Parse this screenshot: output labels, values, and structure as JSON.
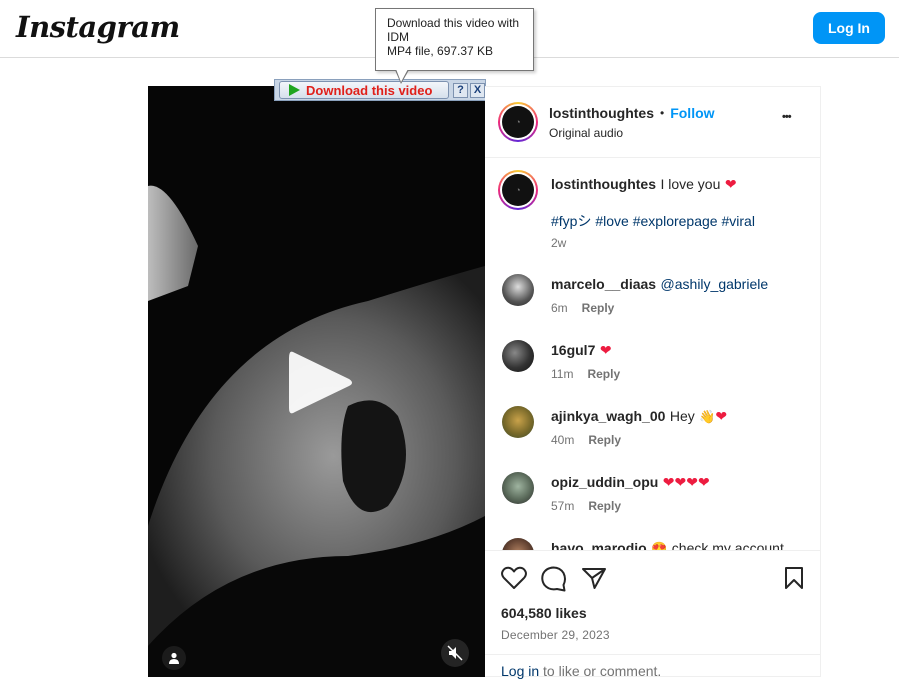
{
  "header": {
    "logo": "Instagram",
    "login_label": "Log In"
  },
  "idm": {
    "button_label": "Download this video",
    "help_label": "?",
    "close_label": "X",
    "tooltip_line1": "Download this video with",
    "tooltip_line2": "IDM",
    "tooltip_line3": "MP4 file, 697.37 KB"
  },
  "post": {
    "author": "lostinthoughtes",
    "separator": "•",
    "follow_label": "Follow",
    "audio": "Original audio",
    "more_label": "•••",
    "caption_text": "I love you",
    "hashtags": [
      "#fypシ",
      "#love",
      "#explorepage",
      "#viral"
    ],
    "caption_time": "2w",
    "likes": "604,580 likes",
    "date": "December 29, 2023",
    "login_link": "Log in",
    "login_suffix": "to like or comment."
  },
  "comments": [
    {
      "user": "marcelo__diaas",
      "text": "@ashily_gabriele",
      "time": "6m",
      "reply": "Reply"
    },
    {
      "user": "16gul7",
      "text": "",
      "time": "11m",
      "reply": "Reply"
    },
    {
      "user": "ajinkya_wagh_00",
      "text": "Hey",
      "time": "40m",
      "reply": "Reply"
    },
    {
      "user": "opiz_uddin_opu",
      "text": "",
      "time": "57m",
      "reply": "Reply"
    },
    {
      "user": "havo_marodio",
      "text": "check my account",
      "time": "",
      "reply": ""
    }
  ],
  "colors": {
    "accent": "#0095f6",
    "heart": "#ed1c40",
    "link": "#00376b"
  }
}
